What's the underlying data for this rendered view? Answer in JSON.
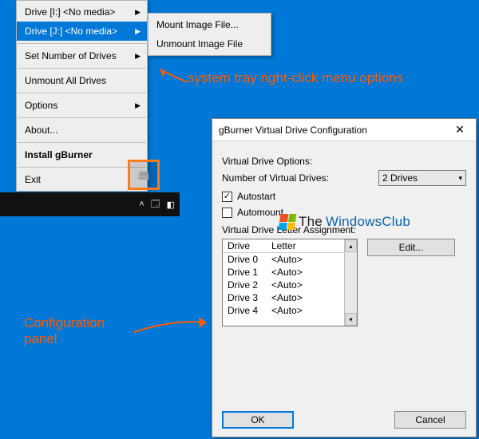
{
  "context_menu": {
    "items": [
      {
        "label": "Drive [I:] <No media>",
        "submenu": true
      },
      {
        "label": "Drive [J:] <No media>",
        "submenu": true,
        "highlighted": true
      },
      {
        "sep": true
      },
      {
        "label": "Set Number of Drives",
        "submenu": true
      },
      {
        "sep": true
      },
      {
        "label": "Unmount All Drives"
      },
      {
        "sep": true
      },
      {
        "label": "Options",
        "submenu": true
      },
      {
        "sep": true
      },
      {
        "label": "About..."
      },
      {
        "sep": true
      },
      {
        "label": "Install gBurner",
        "bold": true
      },
      {
        "sep": true
      },
      {
        "label": "Exit"
      }
    ],
    "submenu": [
      {
        "label": "Mount Image File..."
      },
      {
        "label": "Unmount Image File"
      }
    ]
  },
  "annotations": {
    "tray": "system tray right-click menu options",
    "config": "Configuration\npanel"
  },
  "dialog": {
    "title": "gBurner Virtual Drive Configuration",
    "group1": "Virtual Drive Options:",
    "num_drives_label": "Number of Virtual Drives:",
    "num_drives_value": "2 Drives",
    "autostart": {
      "label": "Autostart",
      "checked": true
    },
    "automount": {
      "label": "Automount",
      "checked": false
    },
    "group2": "Virtual Drive Letter Assignment:",
    "columns": {
      "drive": "Drive",
      "letter": "Letter"
    },
    "rows": [
      {
        "drive": "Drive 0",
        "letter": "<Auto>"
      },
      {
        "drive": "Drive 1",
        "letter": "<Auto>"
      },
      {
        "drive": "Drive 2",
        "letter": "<Auto>"
      },
      {
        "drive": "Drive 3",
        "letter": "<Auto>"
      },
      {
        "drive": "Drive 4",
        "letter": "<Auto>"
      }
    ],
    "edit": "Edit...",
    "ok": "OK",
    "cancel": "Cancel"
  },
  "watermark": {
    "t1": "The",
    "t2": "WindowsClub"
  }
}
